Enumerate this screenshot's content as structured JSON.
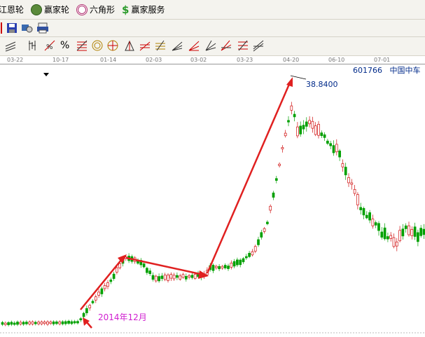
{
  "menu": [
    {
      "label": "江恩轮",
      "icon": "gann-wheel-icon"
    },
    {
      "label": "赢家轮",
      "icon": "winner-wheel-icon"
    },
    {
      "label": "六角形",
      "icon": "hexagon-icon"
    },
    {
      "label": "赢家服务",
      "icon": "dollar-icon"
    }
  ],
  "dates": [
    "03-22",
    "10-17",
    "01-14",
    "02-03",
    "03-02",
    "03-23",
    "04-20",
    "06-10",
    "07-01"
  ],
  "stock": {
    "code": "601766",
    "name": "中国中车"
  },
  "price_label": "38.8400",
  "annotation": "2014年12月",
  "colors": {
    "up": "#d01010",
    "down": "#00a000",
    "arrow": "#e02020",
    "annotation": "#d020d0",
    "label": "#002a8a"
  }
}
